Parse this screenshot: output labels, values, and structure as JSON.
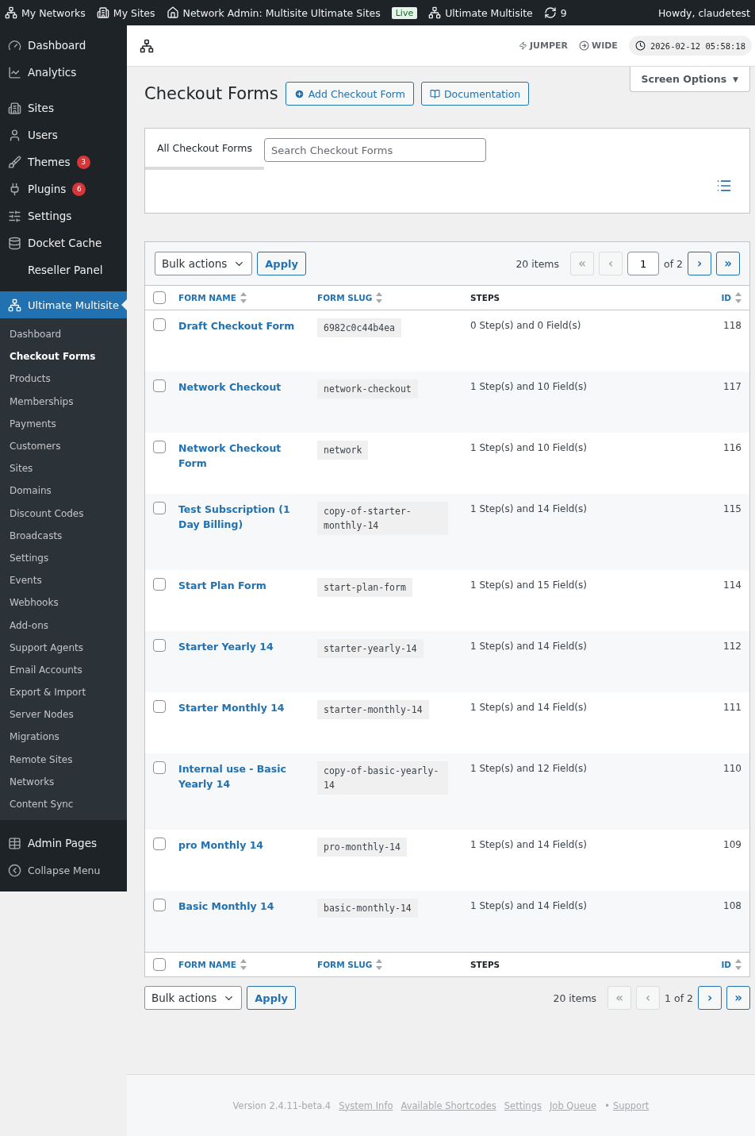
{
  "admin_bar": {
    "items": [
      {
        "kind": "link",
        "label": "My Networks"
      },
      {
        "kind": "link",
        "label": "My Sites"
      },
      {
        "kind": "link",
        "label": "Network Admin: Multisite Ultimate Sites"
      },
      {
        "kind": "badge",
        "label": "Live"
      },
      {
        "kind": "link",
        "label": "Ultimate Multisite"
      },
      {
        "kind": "link",
        "label": "9"
      }
    ],
    "greeting": "Howdy, claudetest"
  },
  "sidebar": {
    "items": [
      {
        "label": "Dashboard",
        "selected": false
      },
      {
        "label": "Analytics",
        "selected": false
      },
      {
        "label": "Sites",
        "selected": false
      },
      {
        "label": "Users",
        "selected": false
      },
      {
        "label": "Themes",
        "badge": "3",
        "selected": false
      },
      {
        "label": "Plugins",
        "badge": "6",
        "selected": false
      },
      {
        "label": "Settings",
        "selected": false
      },
      {
        "label": "Docket Cache",
        "selected": false
      },
      {
        "label": "Reseller Panel",
        "selected": false
      },
      {
        "label": "Ultimate Multisite",
        "selected": true,
        "children": [
          {
            "label": "Dashboard",
            "selected": false
          },
          {
            "label": "Checkout Forms",
            "selected": true
          },
          {
            "label": "Products",
            "selected": false
          },
          {
            "label": "Memberships",
            "selected": false
          },
          {
            "label": "Payments",
            "selected": false
          },
          {
            "label": "Customers",
            "selected": false
          },
          {
            "label": "Sites",
            "selected": false
          },
          {
            "label": "Domains",
            "selected": false
          },
          {
            "label": "Discount Codes",
            "selected": false
          },
          {
            "label": "Broadcasts",
            "selected": false
          },
          {
            "label": "Settings",
            "selected": false
          },
          {
            "label": "Events",
            "selected": false
          },
          {
            "label": "Webhooks",
            "selected": false
          },
          {
            "label": "Add-ons",
            "selected": false
          },
          {
            "label": "Support Agents",
            "selected": false
          },
          {
            "label": "Email Accounts",
            "selected": false
          },
          {
            "label": "Export & Import",
            "selected": false
          },
          {
            "label": "Server Nodes",
            "selected": false
          },
          {
            "label": "Migrations",
            "selected": false
          },
          {
            "label": "Remote Sites",
            "selected": false
          },
          {
            "label": "Networks",
            "selected": false
          },
          {
            "label": "Content Sync",
            "selected": false
          }
        ]
      },
      {
        "label": "Admin Pages",
        "selected": false
      },
      {
        "label": "Collapse Menu",
        "selected": false
      }
    ]
  },
  "top_strip": {
    "jumper": "JUMPER",
    "wide": "WIDE",
    "clock": "2026-02-12 05:58:18"
  },
  "page": {
    "title": "Checkout Forms",
    "buttons": [
      "Add Checkout Form",
      "Documentation"
    ],
    "screen_options": "Screen Options",
    "screen_options_caret": "▼"
  },
  "filter": {
    "tabs": [
      {
        "label": "All Checkout Forms",
        "selected": true
      }
    ],
    "search": {
      "placeholder": "Search Checkout Forms"
    }
  },
  "table": {
    "top_toolbar": {
      "bulk_actions": "Bulk actions",
      "apply": "Apply",
      "items": "20 items",
      "page": "1",
      "of": "of 2",
      "pager": [
        {
          "label": "«",
          "disabled": true
        },
        {
          "label": "‹",
          "disabled": true
        },
        {
          "label": "›",
          "disabled": false
        },
        {
          "label": "»",
          "disabled": false
        }
      ]
    },
    "header": {
      "select_all_checked": false,
      "columns": [
        {
          "label": "FORM NAME",
          "sortable": true
        },
        {
          "label": "FORM SLUG",
          "sortable": true
        },
        {
          "label": "STEPS",
          "sortable": false
        },
        {
          "label": "ID",
          "sortable": true
        }
      ]
    },
    "rows": [
      {
        "name": "Draft Checkout Form",
        "slug": "6982c0c44b4ea",
        "steps": "0 Step(s) and 0 Field(s)",
        "id": "118",
        "checked": false
      },
      {
        "name": "Network Checkout",
        "slug": "network-checkout",
        "steps": "1 Step(s) and 10 Field(s)",
        "id": "117",
        "checked": false
      },
      {
        "name": "Network Checkout Form",
        "slug": "network",
        "steps": "1 Step(s) and 10 Field(s)",
        "id": "116",
        "checked": false
      },
      {
        "name": "Test Subscription (1 Day Billing)",
        "slug": "copy-of-starter-monthly-14",
        "steps": "1 Step(s) and 14 Field(s)",
        "id": "115",
        "checked": false
      },
      {
        "name": "Start Plan Form",
        "slug": "start-plan-form",
        "steps": "1 Step(s) and 15 Field(s)",
        "id": "114",
        "checked": false
      },
      {
        "name": "Starter Yearly 14",
        "slug": "starter-yearly-14",
        "steps": "1 Step(s) and 14 Field(s)",
        "id": "112",
        "checked": false
      },
      {
        "name": "Starter Monthly 14",
        "slug": "starter-monthly-14",
        "steps": "1 Step(s) and 14 Field(s)",
        "id": "111",
        "checked": false
      },
      {
        "name": "Internal use - Basic Yearly 14",
        "slug": "copy-of-basic-yearly-14",
        "steps": "1 Step(s) and 12 Field(s)",
        "id": "110",
        "checked": false
      },
      {
        "name": "pro Monthly 14",
        "slug": "pro-monthly-14",
        "steps": "1 Step(s) and 14 Field(s)",
        "id": "109",
        "checked": false
      },
      {
        "name": "Basic Monthly 14",
        "slug": "basic-monthly-14",
        "steps": "1 Step(s) and 14 Field(s)",
        "id": "108",
        "checked": false
      }
    ],
    "footer_header": {
      "select_all_checked": false,
      "columns": [
        {
          "label": "FORM NAME",
          "sortable": true
        },
        {
          "label": "FORM SLUG",
          "sortable": true
        },
        {
          "label": "STEPS",
          "sortable": false
        },
        {
          "label": "ID",
          "sortable": true
        }
      ]
    },
    "bottom_toolbar": {
      "bulk_actions": "Bulk actions",
      "apply": "Apply",
      "items": "20 items",
      "page": "1 of 2",
      "pager": [
        {
          "label": "«",
          "disabled": true
        },
        {
          "label": "‹",
          "disabled": true
        },
        {
          "label": "›",
          "disabled": false
        },
        {
          "label": "»",
          "disabled": false
        }
      ]
    }
  },
  "footer": {
    "version": "Version 2.4.11-beta.4",
    "links": [
      "System Info",
      "Available Shortcodes",
      "Settings",
      "Job Queue"
    ],
    "bullet": "•",
    "support": "Support"
  }
}
